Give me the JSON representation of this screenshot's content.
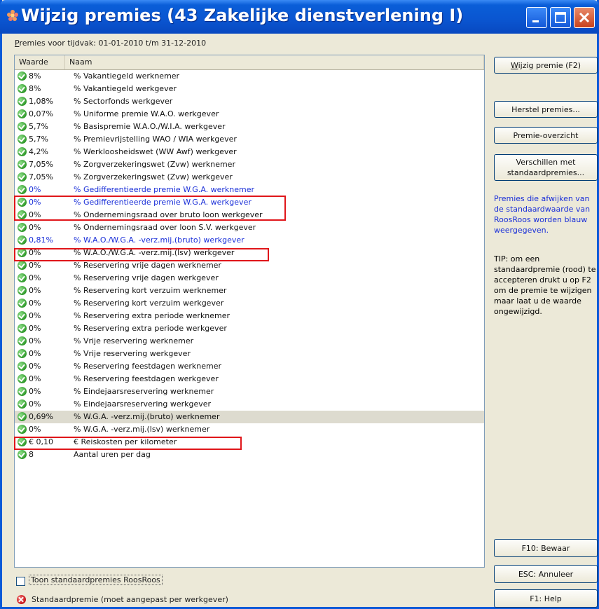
{
  "window": {
    "title": "Wijzig premies (43 Zakelijke dienstverlening I)",
    "period_prefix": "remies voor tijdvak",
    "period_underline": "P",
    "period_range": "01-01-2010 t/m 31-12-2010"
  },
  "list": {
    "columns": [
      "Waarde",
      "Naam"
    ],
    "rows": [
      {
        "value": "8%",
        "name": "% Vakantiegeld werknemer"
      },
      {
        "value": "8%",
        "name": "% Vakantiegeld werkgever"
      },
      {
        "value": "1,08%",
        "name": "% Sectorfonds werkgever"
      },
      {
        "value": "0,07%",
        "name": "% Uniforme premie W.A.O. werkgever"
      },
      {
        "value": "5,7%",
        "name": "% Basispremie W.A.O./W.I.A. werkgever"
      },
      {
        "value": "5,7%",
        "name": "% Premievrijstelling WAO / WIA werkgever"
      },
      {
        "value": "4,2%",
        "name": "% Werkloosheidswet (WW Awf) werkgever"
      },
      {
        "value": "7,05%",
        "name": "% Zorgverzekeringswet (Zvw) werknemer"
      },
      {
        "value": "7,05%",
        "name": "% Zorgverzekeringswet (Zvw) werkgever"
      },
      {
        "value": "0%",
        "name": "% Gedifferentieerde premie W.G.A. werknemer",
        "blue": true
      },
      {
        "value": "0%",
        "name": "% Gedifferentieerde premie W.G.A. werkgever",
        "blue": true
      },
      {
        "value": "0%",
        "name": "% Ondernemingsraad over bruto loon werkgever"
      },
      {
        "value": "0%",
        "name": "% Ondernemingsraad over loon S.V. werkgever"
      },
      {
        "value": "0,81%",
        "name": "% W.A.O./W.G.A. -verz.mij.(bruto) werkgever",
        "blue": true
      },
      {
        "value": "0%",
        "name": "% W.A.O./W.G.A. -verz.mij.(lsv) werkgever"
      },
      {
        "value": "0%",
        "name": "% Reservering vrije dagen werknemer"
      },
      {
        "value": "0%",
        "name": "% Reservering vrije dagen werkgever"
      },
      {
        "value": "0%",
        "name": "% Reservering kort verzuim werknemer"
      },
      {
        "value": "0%",
        "name": "% Reservering kort verzuim werkgever"
      },
      {
        "value": "0%",
        "name": "% Reservering extra periode werknemer"
      },
      {
        "value": "0%",
        "name": "% Reservering extra periode werkgever"
      },
      {
        "value": "0%",
        "name": "% Vrije reservering werknemer"
      },
      {
        "value": "0%",
        "name": "% Vrije reservering werkgever"
      },
      {
        "value": "0%",
        "name": "% Reservering feestdagen werknemer"
      },
      {
        "value": "0%",
        "name": "% Reservering feestdagen werkgever"
      },
      {
        "value": "0%",
        "name": "% Eindejaarsreservering werknemer"
      },
      {
        "value": "0%",
        "name": "% Eindejaarsreservering werkgever"
      },
      {
        "value": "0,69%",
        "name": "% W.G.A. -verz.mij.(bruto) werknemer",
        "highlight": true
      },
      {
        "value": "0%",
        "name": "% W.G.A. -verz.mij.(lsv) werknemer"
      },
      {
        "value": "€ 0,10",
        "name": "€ Reiskosten per kilometer"
      },
      {
        "value": "8",
        "name": "Aantal uren per dag"
      }
    ]
  },
  "buttons": {
    "wijzig": "Wijzig premie (F2)",
    "herstel": "Herstel premies...",
    "overzicht": "Premie-overzicht",
    "verschillen_1": "Verschillen met",
    "verschillen_2": "standaardpremies...",
    "bewaar": "F10: Bewaar",
    "annuleer": "ESC: Annuleer",
    "help": "F1: Help"
  },
  "info": {
    "blue_note": "Premies die afwijken van de standaardwaarde van RoosRoos worden blauw weergegeven.",
    "tip": "TIP: om een standaardpremie (rood) te accepteren drukt u op F2 om de premie te wijzigen maar laat u de waarde ongewijzigd."
  },
  "footer": {
    "checkbox_label": "Toon standaardpremies RoosRoos",
    "legend_text": "Standaardpremie (moet aangepast per werkgever)"
  },
  "colors": {
    "accent_blue": "#1a2fd8",
    "annotation_red": "#e0161a",
    "ok_green": "#2f9a2a"
  }
}
